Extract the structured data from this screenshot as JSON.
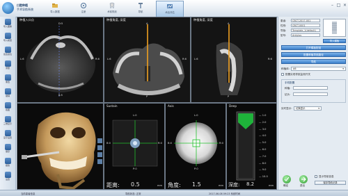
{
  "app": {
    "name_line1": "口腔种植",
    "name_line2": "手术导航系统"
  },
  "tabs": [
    {
      "label": "导入数据"
    },
    {
      "label": "注册"
    },
    {
      "label": "术前规划"
    },
    {
      "label": "导航"
    },
    {
      "label": "术后评估"
    }
  ],
  "left_tools": [
    {
      "label": "导入图像"
    },
    {
      "label": "导入模型"
    },
    {
      "label": "窗宽窗位"
    },
    {
      "label": "测量"
    },
    {
      "label": "重置"
    },
    {
      "label": "撤销"
    },
    {
      "label": "截图"
    },
    {
      "label": "三维显示"
    },
    {
      "label": "显示设置"
    },
    {
      "label": "保存"
    },
    {
      "label": "报告"
    },
    {
      "label": "设置"
    }
  ],
  "viewer": {
    "p1": {
      "title": "种植入口点",
      "top": "D:5",
      "left": "L:6",
      "right": "R:6",
      "bottom": "B:5"
    },
    "p2": {
      "title": "种植角度, 深度",
      "top": "A",
      "left": "L:6",
      "right": "R:6",
      "bottom": "P"
    },
    "p3": {
      "title": "种植角度, 深度",
      "top": "A",
      "left": "L:6",
      "right": "R:6",
      "bottom": "P"
    },
    "p5": {
      "title": "Sustain",
      "top": "L:0",
      "left": "B:0",
      "right": "R:0",
      "bottom": "P:0"
    },
    "p6": {
      "title": "Axis",
      "top": "L:0",
      "left": "B:0",
      "right": "R:0",
      "bottom": "P:0"
    },
    "p7": {
      "title": "Deep",
      "scale": [
        "1.0",
        "2.0",
        "3.0",
        "4.0",
        "5.0",
        "6.0",
        "7.0",
        "8.0",
        "9.0",
        "10.0"
      ]
    },
    "readouts": {
      "distance_label": "距离:",
      "distance_value": "0.5",
      "distance_unit": "mm",
      "angle_label": "角度:",
      "angle_value": "1.5",
      "angle_unit": "mm",
      "depth_label": "深度:",
      "depth_value": "8.2",
      "depth_unit": "mm"
    }
  },
  "right": {
    "fields": [
      {
        "label": "患者:",
        "value": "CBCT-2017-001"
      },
      {
        "label": "性别:",
        "value": "CBCT-0001"
      },
      {
        "label": "导板:",
        "value": "Template_1(default)"
      },
      {
        "label": "型号:",
        "value": "Ankylos"
      }
    ],
    "btn_load": "导入模板",
    "btn1": "打开模板配准",
    "btn2": "配置种植导航路径",
    "btn3": "导航",
    "sel1_label": "种植体:",
    "sel1_value": "A6",
    "check1": "配置实现导航监测开关",
    "group_title": "手机配置",
    "g1_label": "种植:",
    "g1_value": "",
    "g2_label": "钻头:",
    "g2_value": "",
    "sel2_label": "实时显示:",
    "sel2_value": "切换显示",
    "bottom_btn1": "确定",
    "bottom_btn2": "退出",
    "check2": "显示导航信息",
    "btn_save": "保存导航记录"
  },
  "status": {
    "left": "当前患者信息",
    "mid": "导航状态: 正常",
    "right": "2017-06-08  09:23  系统时间"
  },
  "colors": {
    "accent": "#3b7fcb",
    "implant_line": "#f0a020",
    "deep_fill": "#1eb33a",
    "crosshair": "#22c22c"
  }
}
